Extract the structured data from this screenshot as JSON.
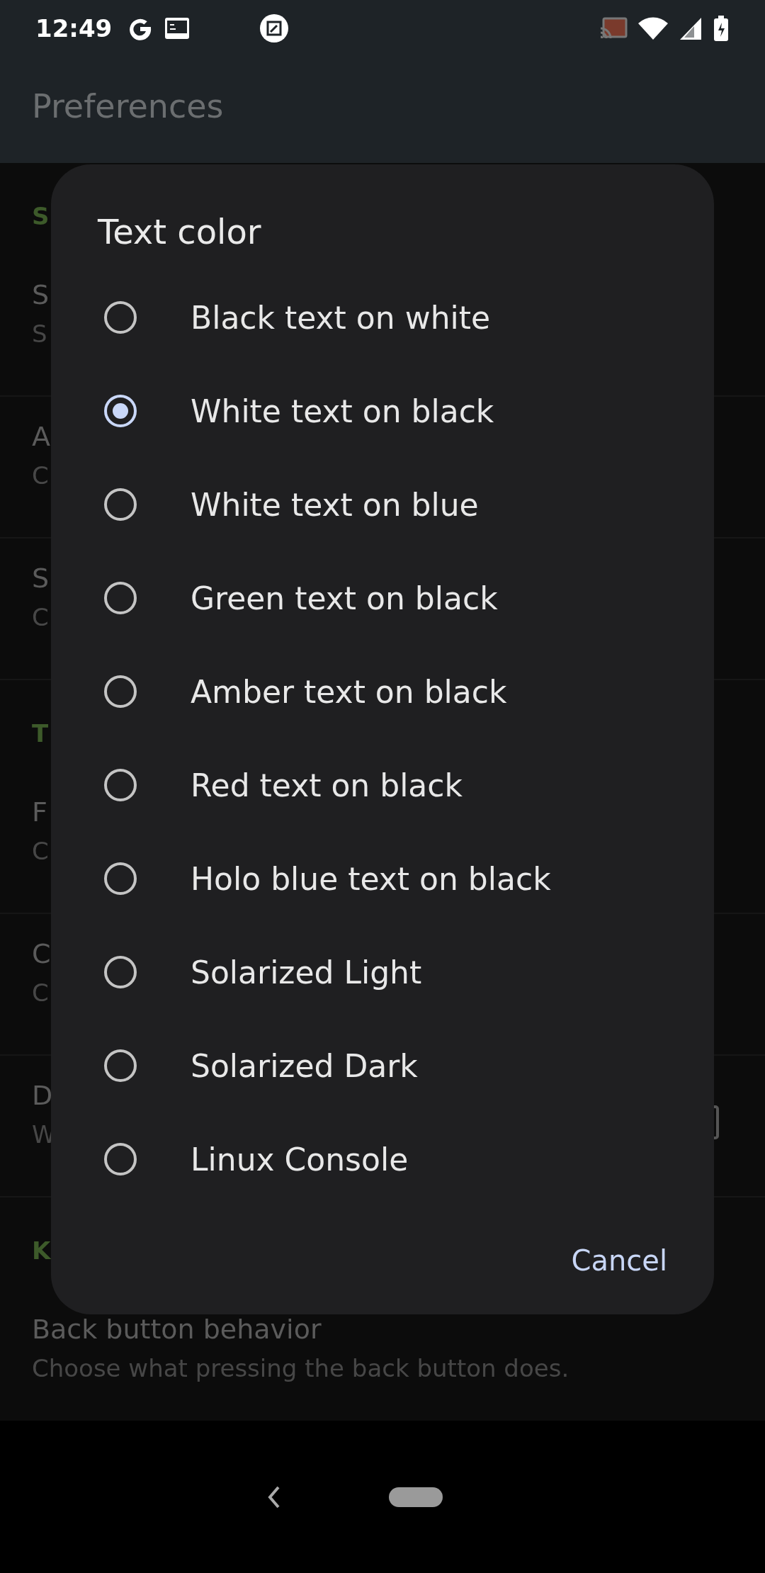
{
  "status_bar": {
    "time": "12:49"
  },
  "app_bar": {
    "title": "Preferences"
  },
  "settings": [
    {
      "kind": "header",
      "title": "S"
    },
    {
      "kind": "item",
      "title": "S",
      "summary": "S"
    },
    {
      "kind": "item",
      "title": "A",
      "summary": "C"
    },
    {
      "kind": "item",
      "title": "S",
      "summary": "C"
    },
    {
      "kind": "header",
      "title": "T"
    },
    {
      "kind": "item",
      "title": "F",
      "summary": "C"
    },
    {
      "kind": "item",
      "title": "C",
      "summary": "C"
    },
    {
      "kind": "checkbox",
      "title": "D",
      "summary": "W",
      "checked": false
    },
    {
      "kind": "header",
      "title": "K"
    },
    {
      "kind": "item",
      "title": "Back button behavior",
      "summary": "Choose what pressing the back button does."
    }
  ],
  "dialog": {
    "title": "Text color",
    "options": [
      {
        "label": "Black text on white",
        "selected": false
      },
      {
        "label": "White text on black",
        "selected": true
      },
      {
        "label": "White text on blue",
        "selected": false
      },
      {
        "label": "Green text on black",
        "selected": false
      },
      {
        "label": "Amber text on black",
        "selected": false
      },
      {
        "label": "Red text on black",
        "selected": false
      },
      {
        "label": "Holo blue text on black",
        "selected": false
      },
      {
        "label": "Solarized Light",
        "selected": false
      },
      {
        "label": "Solarized Dark",
        "selected": false
      },
      {
        "label": "Linux Console",
        "selected": false
      }
    ],
    "cancel": "Cancel"
  }
}
